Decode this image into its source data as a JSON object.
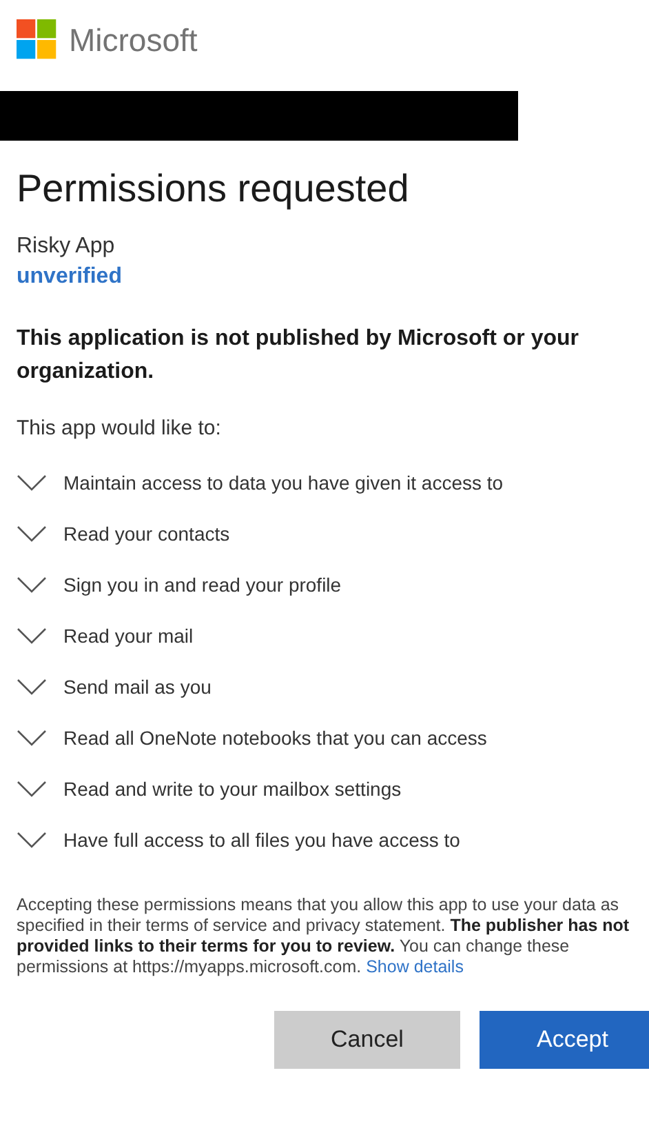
{
  "brand": {
    "name": "Microsoft"
  },
  "title": "Permissions requested",
  "app": {
    "name": "Risky App",
    "status": "unverified"
  },
  "warning": "This application is not published by Microsoft or your organization.",
  "intro": "This app would like to:",
  "permissions": [
    {
      "label": "Maintain access to data you have given it access to",
      "expanded": false
    },
    {
      "label": "Read your contacts",
      "expanded": false
    },
    {
      "label": "Sign you in and read your profile",
      "expanded": false
    },
    {
      "label": "Read your mail",
      "expanded": false
    },
    {
      "label": "Send mail as you",
      "expanded": false
    },
    {
      "label": "Read all OneNote notebooks that you can access",
      "expanded": false
    },
    {
      "label": "Read and write to your mailbox settings",
      "expanded": false
    },
    {
      "label": "Have full access to all files you have access to",
      "expanded": false
    }
  ],
  "notice": {
    "text": "Accepting these permissions means that you allow this app to use your data as specified in their terms of service and privacy statement. **The publisher has not provided links to their terms for you to review.** You can change these permissions at https://myapps.microsoft.com.",
    "link": "Show details"
  },
  "buttons": [
    {
      "label": "Cancel",
      "kind": "secondary"
    },
    {
      "label": "Accept",
      "kind": "primary"
    }
  ]
}
